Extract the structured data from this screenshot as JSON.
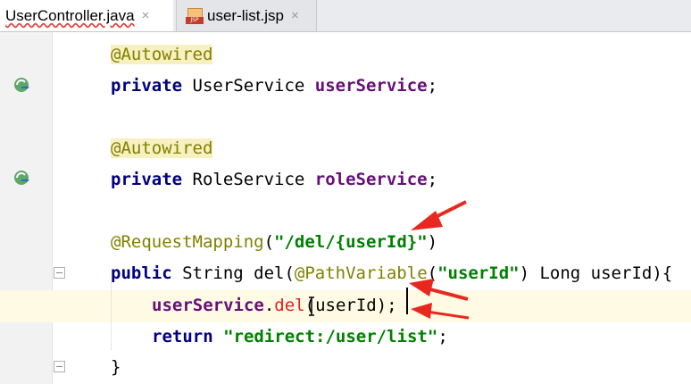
{
  "tabs": [
    {
      "label": "UserController.java",
      "active": true
    },
    {
      "label": "user-list.jsp",
      "active": false,
      "icon_text": "JSP"
    }
  ],
  "tab_close_glyph": "×",
  "gutter_icons": [
    "override-implement-icon",
    "override-implement-icon"
  ],
  "code": {
    "l1": {
      "ann": "@Autowired"
    },
    "l2": {
      "kw": "private",
      "type": " UserService ",
      "field": "userService",
      "end": ";"
    },
    "l4": {
      "ann": "@Autowired"
    },
    "l5": {
      "kw": "private",
      "type": " RoleService ",
      "field": "roleService",
      "end": ";"
    },
    "l7": {
      "ann": "@RequestMapping",
      "open": "(",
      "str": "\"/del/{userId}\"",
      "close": ")"
    },
    "l8": {
      "kw": "public",
      "rest1": " String del(",
      "ann": "@PathVariable",
      "open": "(",
      "str": "\"userId\"",
      "rest2": ") Long userId){"
    },
    "l9": {
      "field": "userService",
      "dot": ".",
      "method": "del",
      "rest": "(userId);"
    },
    "l10": {
      "kw": "return",
      "sp": " ",
      "str": "\"redirect:/user/list\"",
      "end": ";"
    },
    "l11": {
      "brace": "}"
    }
  },
  "colors": {
    "keyword": "#000080",
    "annotation": "#808000",
    "field": "#660e7a",
    "string": "#008000",
    "annotation_arrow": "#e8281e",
    "caret_row": "#fffae3"
  }
}
